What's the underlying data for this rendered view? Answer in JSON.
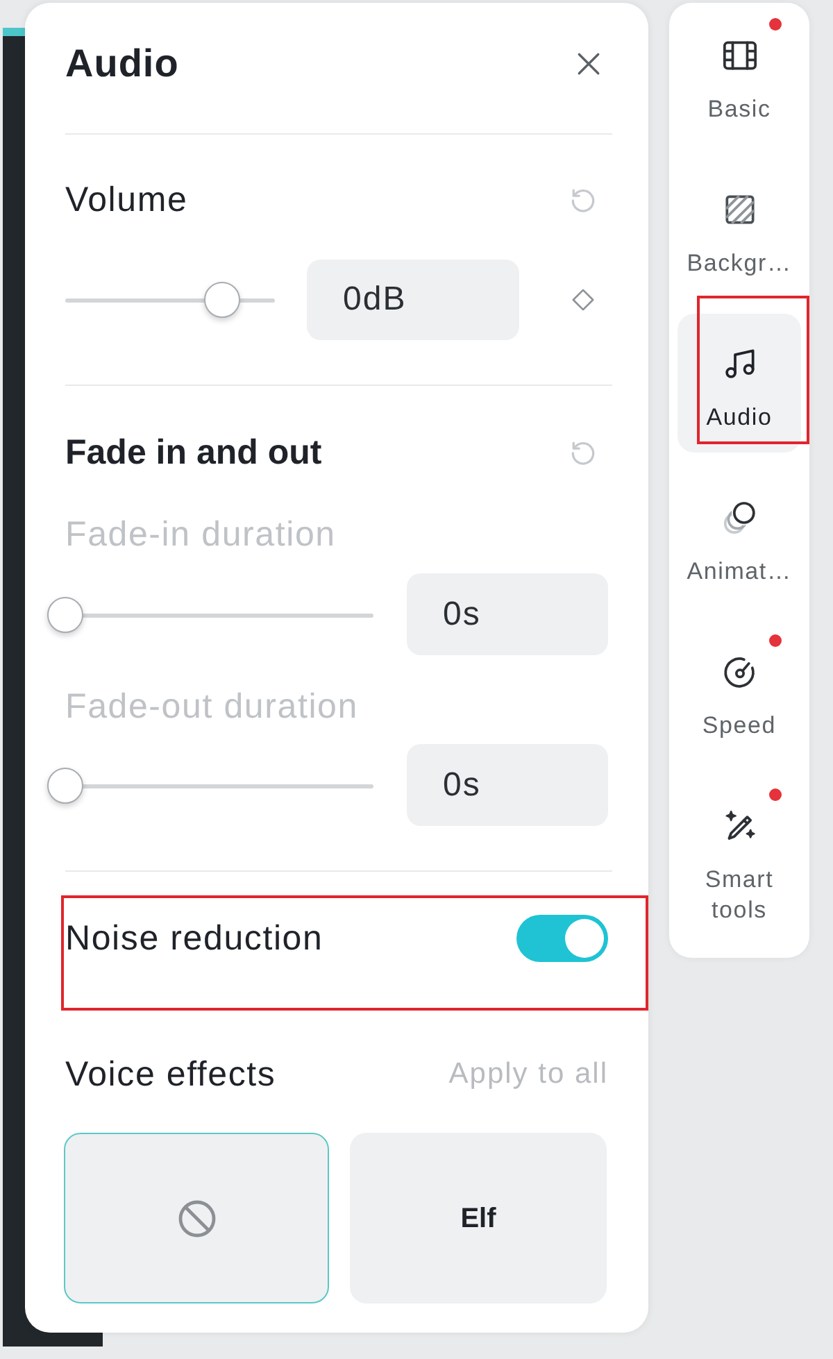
{
  "panel": {
    "title": "Audio",
    "volume": {
      "title": "Volume",
      "level": 0.75,
      "value": "0dB"
    },
    "fade": {
      "title": "Fade in and out",
      "sliders": [
        {
          "label": "Fade-in duration",
          "level": 0,
          "value": "0s"
        },
        {
          "label": "Fade-out duration",
          "level": 0,
          "value": "0s"
        }
      ]
    },
    "noise_reduction": {
      "label": "Noise reduction",
      "on": true,
      "highlighted": true
    },
    "voice_effects": {
      "title": "Voice effects",
      "action": "Apply to all",
      "effects": [
        {
          "kind": "none",
          "selected": true
        },
        {
          "kind": "preset",
          "label": "Elf",
          "selected": false
        }
      ]
    }
  },
  "sidebar": {
    "items": [
      {
        "label": "Basic",
        "badge": true,
        "selected": false,
        "highlighted": false
      },
      {
        "label": "Backgr…",
        "badge": false,
        "selected": false,
        "highlighted": false
      },
      {
        "label": "Audio",
        "badge": false,
        "selected": true,
        "highlighted": true
      },
      {
        "label": "Animat…",
        "badge": false,
        "selected": false,
        "highlighted": false
      },
      {
        "label": "Speed",
        "badge": true,
        "selected": false,
        "highlighted": false
      },
      {
        "label": "Smart tools",
        "badge": true,
        "selected": false,
        "highlighted": false
      }
    ]
  }
}
